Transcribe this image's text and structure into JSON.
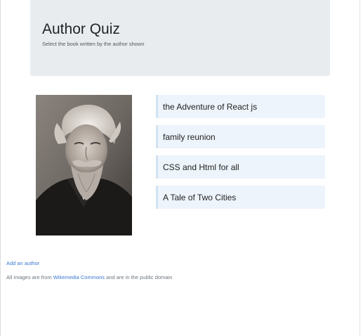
{
  "header": {
    "title": "Author Quiz",
    "subtitle": "Select the book written by the author shown"
  },
  "turn": {
    "author_image_alt": "Author",
    "books": [
      "the Adventure of React js",
      "family reunion",
      "CSS and Html for all",
      "A Tale of Two Cities"
    ]
  },
  "footer": {
    "add_author": "Add an author",
    "note_prefix": "All images are from",
    "note_link": "Wikemedia Commons",
    "note_suffix": "and are in the public domain"
  },
  "colors": {
    "jumbotron_bg": "#e9ecef",
    "answer_bg": "#edf4fb",
    "answer_border": "#d2e3f2",
    "link": "#3a78d0"
  }
}
